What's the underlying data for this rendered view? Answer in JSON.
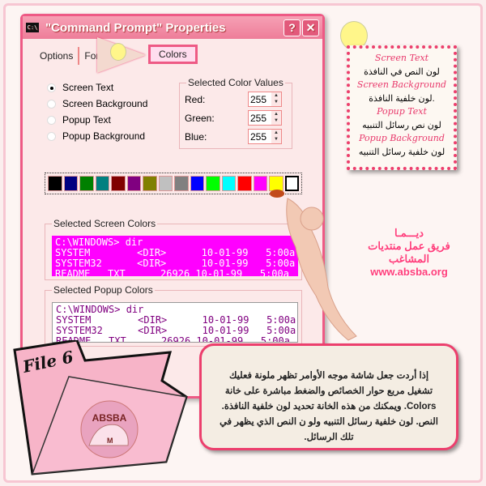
{
  "dialog": {
    "title": "\"Command Prompt\" Properties",
    "help_label": "?",
    "close_label": "✕",
    "tabs": [
      {
        "label": "Options"
      },
      {
        "label": "Font"
      },
      {
        "label": "Colors"
      }
    ],
    "radios": [
      {
        "label": "Screen Text",
        "checked": true
      },
      {
        "label": "Screen Background",
        "checked": false
      },
      {
        "label": "Popup Text",
        "checked": false
      },
      {
        "label": "Popup Background",
        "checked": false
      }
    ],
    "color_values": {
      "label": "Selected Color Values",
      "red_label": "Red:",
      "red": "255",
      "green_label": "Green:",
      "green": "255",
      "blue_label": "Blue:",
      "blue": "255"
    },
    "palette": [
      "#000000",
      "#000080",
      "#008000",
      "#008080",
      "#800000",
      "#800080",
      "#808000",
      "#c0c0c0",
      "#808080",
      "#0000ff",
      "#00ff00",
      "#00ffff",
      "#ff0000",
      "#ff00ff",
      "#ffff00",
      "#ffffff"
    ],
    "selected_swatch": 15,
    "screen_colors": {
      "label": "Selected Screen Colors",
      "text_color": "#ffffff",
      "bg_color": "#ff00ff",
      "lines": [
        "C:\\WINDOWS> dir",
        "SYSTEM        <DIR>      10-01-99   5:00a",
        "SYSTEM32      <DIR>      10-01-99   5:00a",
        "README   TXT      26926 10-01-99   5:00a"
      ]
    },
    "popup_colors": {
      "label": "Selected Popup Colors",
      "text_color": "#800080",
      "bg_color": "#ffffff",
      "lines": [
        "C:\\WINDOWS> dir",
        "SYSTEM        <DIR>      10-01-99   5:00a",
        "SYSTEM32      <DIR>      10-01-99   5:00a",
        "README   TXT      26926 10-01-99   5:00a"
      ]
    }
  },
  "note": {
    "items": [
      {
        "en": "Screen Text",
        "ar": "لون النص في النافذة"
      },
      {
        "en": "Screen Background",
        "ar": "لون خلفية النافذة."
      },
      {
        "en": "Popup Text",
        "ar": "لون نص رسائل التنبيه"
      },
      {
        "en": "Popup Background",
        "ar": "لون خلفية رسائل التنبيه"
      }
    ]
  },
  "credits": {
    "name": "ديـــمـا",
    "team": "فريق عمل منتديات المشاغب",
    "url": "www.absba.org"
  },
  "explanation": "إذا أردت جعل شاشة موجه الأوامر تظهر ملونة فعليك تشغيل مربع حوار الخصائص والضغط مباشرة على خانة Colors. ويمكنك من هذه الخانة تحديد لون خلفية النافذة. النص. لون خلفية رسائل التنبيه ولو ن النص الذي يظهر في تلك الرسائل.",
  "folder": {
    "label": "File 6",
    "logo_text": "ABSBA",
    "logo_letter": "M"
  },
  "accent": "#ec3f6d"
}
